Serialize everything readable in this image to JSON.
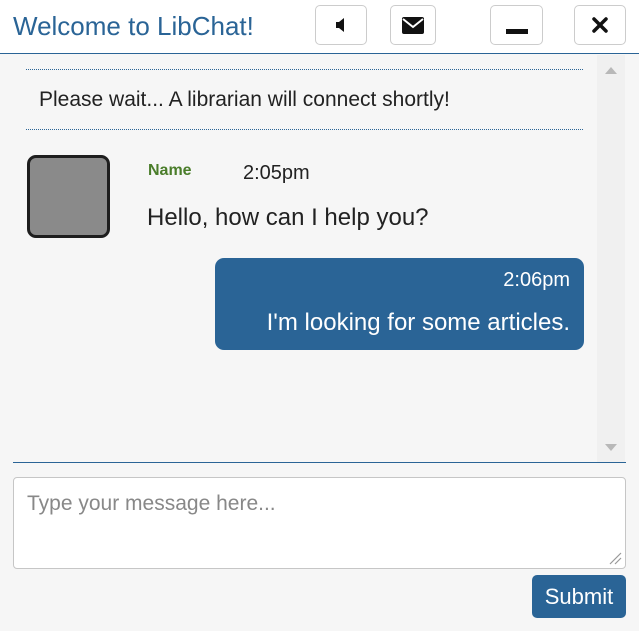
{
  "header": {
    "title": "Welcome to LibChat!",
    "buttons": [
      {
        "name": "sound-button",
        "icon": "speaker-icon"
      },
      {
        "name": "email-transcript-button",
        "icon": "envelope-icon"
      },
      {
        "name": "minimize-button",
        "icon": "minimize-icon"
      },
      {
        "name": "close-button",
        "icon": "close-icon"
      }
    ]
  },
  "transcript": {
    "system_message": "Please wait... A librarian will connect shortly!",
    "messages": [
      {
        "sender": "Name",
        "time": "2:05pm",
        "text": "Hello, how can I help you?",
        "from": "librarian"
      },
      {
        "sender": "",
        "time": "2:06pm",
        "text": "I'm looking for some articles.",
        "from": "patron"
      }
    ]
  },
  "composer": {
    "placeholder": "Type your message here...",
    "value": "",
    "submit_label": "Submit"
  },
  "colors": {
    "accent": "#2a6496",
    "sender_name": "#4a7d2a",
    "background": "#f6f6f6"
  }
}
